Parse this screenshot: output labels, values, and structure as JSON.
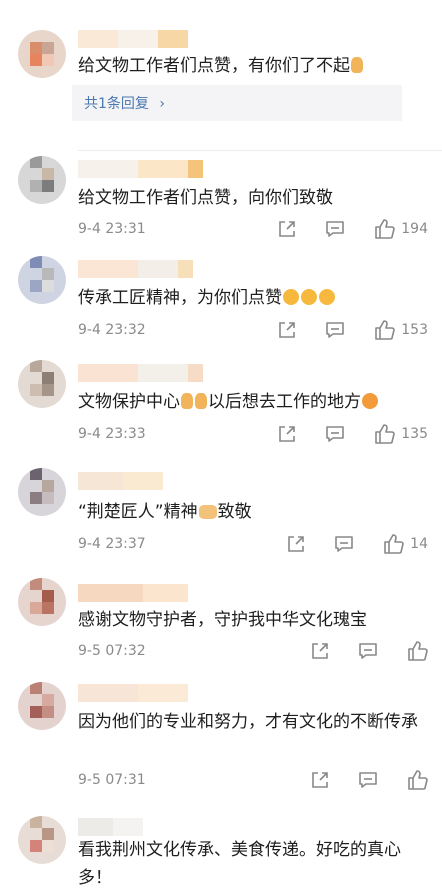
{
  "comments": [
    {
      "text": "给文物工作者们点赞，有你们了不起",
      "emojis": [
        "thumbs-up-emoji"
      ],
      "reply_label": "共1条回复",
      "reply_chevron": "›"
    },
    {
      "text": "给文物工作者们点赞，向你们致敬",
      "time": "9-4 23:31",
      "likes": "194"
    },
    {
      "text": "传承工匠精神，为你们点赞",
      "emojis": [
        "crying-face-emoji",
        "crying-face-emoji",
        "crying-face-emoji"
      ],
      "time": "9-4 23:32",
      "likes": "153"
    },
    {
      "text_a": "文物保护中心",
      "text_b": "以后想去工作的地方",
      "emojis": [
        "thumbs-up-emoji",
        "thumbs-up-emoji",
        "tongue-face-emoji"
      ],
      "time": "9-4 23:33",
      "likes": "135"
    },
    {
      "text_a": "“荆楚匠人”精神",
      "text_b": "致敬",
      "emojis": [
        "praying-hands-emoji"
      ],
      "time": "9-4 23:37",
      "likes": "14"
    },
    {
      "text": "感谢文物守护者，守护我中华文化瑰宝",
      "time": "9-5 07:32",
      "likes": ""
    },
    {
      "text": "因为他们的专业和努力，才有文化的不断传承",
      "time": "9-5 07:31",
      "likes": ""
    },
    {
      "text": "看我荆州文化传承、美食传递。好吃的真心多！"
    }
  ],
  "icons": {
    "share": "share-icon",
    "comment": "comment-icon",
    "like": "thumbs-up-icon"
  },
  "colors": {
    "link": "#4a78b0",
    "meta": "#8a8a8a",
    "reply_bg": "#f4f4f6"
  }
}
